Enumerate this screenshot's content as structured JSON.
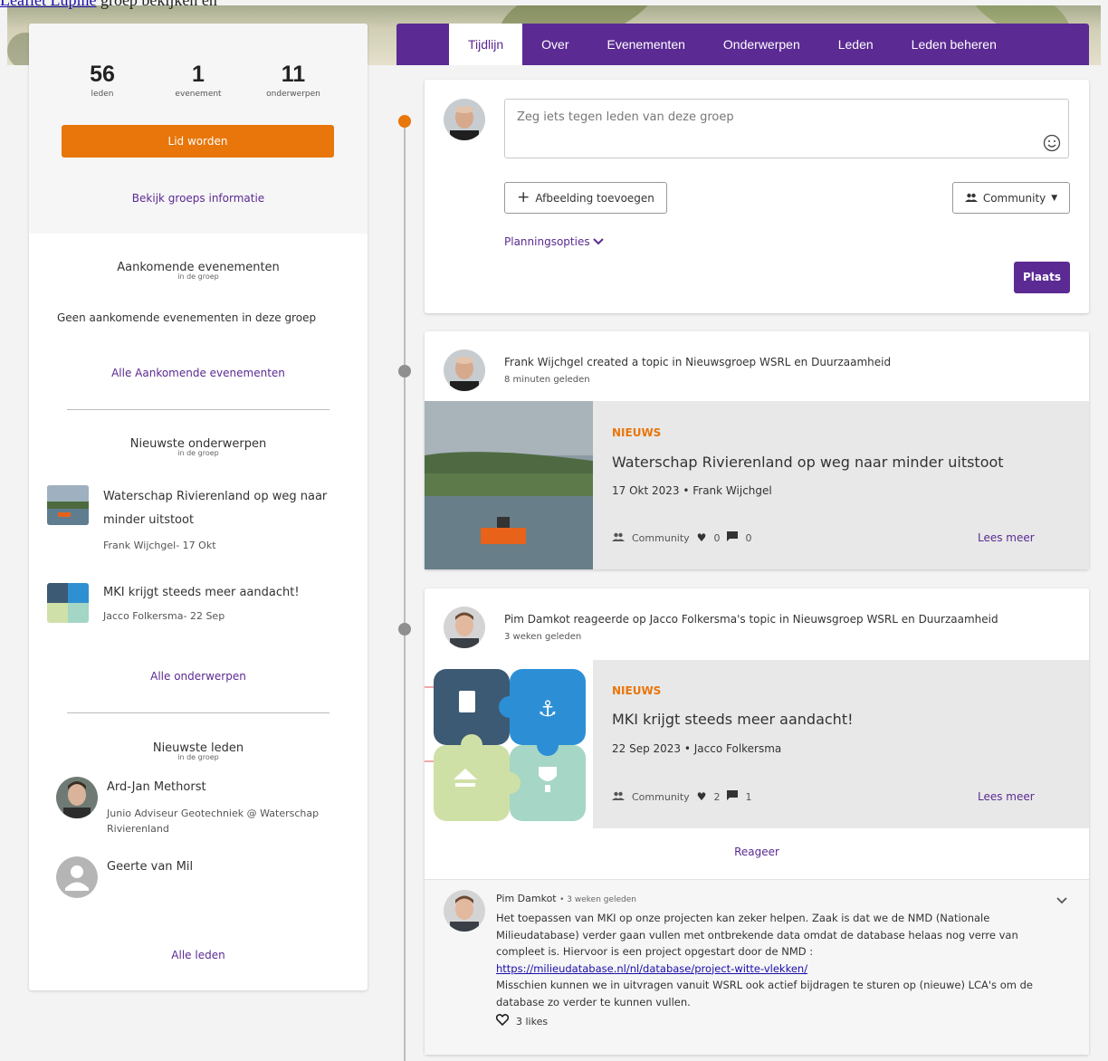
{
  "page": {
    "top_link": "Leaflet Lupiné",
    "top_rest": " groep bekijken en"
  },
  "tabs": [
    "Tijdlijn",
    "Over",
    "Evenementen",
    "Onderwerpen",
    "Leden",
    "Leden beheren"
  ],
  "sidebar": {
    "stats": [
      {
        "num": "56",
        "label": "leden"
      },
      {
        "num": "1",
        "label": "evenement"
      },
      {
        "num": "11",
        "label": "onderwerpen"
      }
    ],
    "join_label": "Lid worden",
    "group_info_label": "Bekijk groeps informatie",
    "events": {
      "title": "Aankomende evenementen",
      "sub": "in de groep",
      "empty": "Geen aankomende evenementen in deze groep",
      "all_label": "Alle Aankomende evenementen"
    },
    "topics": {
      "title": "Nieuwste onderwerpen",
      "sub": "in de groep",
      "items": [
        {
          "title_line1": "Waterschap Rivierenland op weg naar",
          "title_line2": "minder uitstoot",
          "meta": "Frank Wijchgel- 17 Okt"
        },
        {
          "title_line1": "MKI krijgt steeds meer aandacht!",
          "title_line2": "",
          "meta": "Jacco Folkersma- 22 Sep"
        }
      ],
      "all_label": "Alle onderwerpen"
    },
    "members": {
      "title": "Nieuwste leden",
      "sub": "in de groep",
      "items": [
        {
          "name": "Ard-Jan Methorst",
          "role": "Junio Adviseur Geotechniek @ Waterschap Rivierenland"
        },
        {
          "name": "Geerte van Mil",
          "role": ""
        }
      ],
      "all_label": "Alle leden"
    }
  },
  "composer": {
    "placeholder": "Zeg iets tegen leden van deze groep",
    "add_image_label": "Afbeelding toevoegen",
    "visibility_label": "Community",
    "planning_label": "Planningsopties",
    "post_label": "Plaats"
  },
  "feed": [
    {
      "activity": "Frank Wijchgel created a topic in Nieuwsgroep WSRL en Duurzaamheid",
      "time": "8 minuten geleden",
      "tag": "NIEUWS",
      "title": "Waterschap Rivierenland op weg naar minder uitstoot",
      "date": "17 Okt 2023 • Frank Wijchgel",
      "visibility": "Community",
      "likes": "0",
      "comments": "0",
      "more_label": "Lees meer"
    },
    {
      "activity": "Pim Damkot reageerde op Jacco Folkersma's topic in Nieuwsgroep WSRL en Duurzaamheid",
      "time": "3 weken geleden",
      "tag": "NIEUWS",
      "title": "MKI krijgt steeds meer aandacht!",
      "date": "22 Sep 2023 • Jacco Folkersma",
      "visibility": "Community",
      "likes": "2",
      "comments": "1",
      "more_label": "Lees meer",
      "reply_label": "Reageer",
      "comment": {
        "author": "Pim Damkot",
        "time": "• 3 weken geleden",
        "text1": "Het toepassen van MKI op onze projecten kan zeker helpen. Zaak is dat we de NMD (Nationale Milieudatabase) verder gaan vullen met ontbrekende data omdat de database helaas nog verre van compleet is. Hiervoor is een project opgestart door de NMD :",
        "link": "https://milieudatabase.nl/nl/database/project-witte-vlekken/",
        "text2": "Misschien kunnen we in uitvragen vanuit WSRL ook actief bijdragen te sturen op (nieuwe) LCA's om de database zo verder te kunnen vullen.",
        "likes": "3 likes"
      }
    }
  ],
  "colors": {
    "purple": "#5b2a93",
    "orange": "#e8760a",
    "timeline_gray": "#8f8f8f"
  }
}
